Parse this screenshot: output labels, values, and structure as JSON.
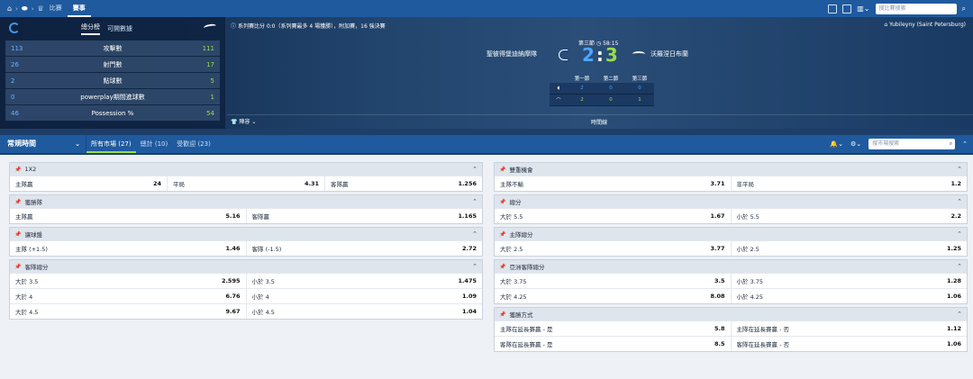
{
  "topbar": {
    "tabs": [
      "比賽",
      "賽事"
    ],
    "active_tab": 1,
    "search_placeholder": "搜比賽搜索"
  },
  "stats": {
    "tabs": [
      "總分榜",
      "可開數據"
    ],
    "rows": [
      {
        "home": "113",
        "name": "攻擊數",
        "away": "111"
      },
      {
        "home": "26",
        "name": "射門數",
        "away": "17"
      },
      {
        "home": "2",
        "name": "點球數",
        "away": "5"
      },
      {
        "home": "0",
        "name": "powerplay期間進球數",
        "away": "1"
      },
      {
        "home": "46",
        "name": "Possession %",
        "away": "54"
      }
    ]
  },
  "match": {
    "series_info": "系列賽比分 0:0（系列賽最多 4 場獲勝），附加賽，16 強決賽",
    "venue": "Yubileyny (Saint Petersburg)",
    "home_team": "聖彼得堡迪納摩隊",
    "away_team": "沃羅涅日布蘭",
    "period": "第三節",
    "clock": "58:15",
    "home_score": "2",
    "away_score": "3",
    "period_headers": [
      "第一節",
      "第二節",
      "第三節"
    ],
    "home_periods": [
      "2",
      "0",
      "0"
    ],
    "away_periods": [
      "2",
      "0",
      "1"
    ],
    "lineup_label": "陣容",
    "timeline_label": "時間線"
  },
  "filter": {
    "period_select": "常規時間",
    "tabs": [
      "所有市場 (27)",
      "總計 (10)",
      "受歡迎 (23)"
    ],
    "search_placeholder": "搜市場搜索"
  },
  "markets_left": [
    {
      "title": "1X2",
      "rows": [
        [
          [
            "主隊贏",
            "24"
          ],
          [
            "平局",
            "4.31"
          ],
          [
            "客隊贏",
            "1.256"
          ]
        ]
      ]
    },
    {
      "title": "獲勝隊",
      "rows": [
        [
          [
            "主隊贏",
            "5.16"
          ],
          [
            "客隊贏",
            "1.165"
          ]
        ]
      ]
    },
    {
      "title": "讓球盤",
      "rows": [
        [
          [
            "主隊 (+1.5)",
            "1.46"
          ],
          [
            "客隊 (-1.5)",
            "2.72"
          ]
        ]
      ]
    },
    {
      "title": "客隊總分",
      "rows": [
        [
          [
            "大於 3.5",
            "2.595"
          ],
          [
            "小於 3.5",
            "1.475"
          ]
        ],
        [
          [
            "大於 4",
            "6.76"
          ],
          [
            "小於 4",
            "1.09"
          ]
        ],
        [
          [
            "大於 4.5",
            "9.67"
          ],
          [
            "小於 4.5",
            "1.04"
          ]
        ]
      ]
    }
  ],
  "markets_right": [
    {
      "title": "雙重機會",
      "rows": [
        [
          [
            "主隊不輸",
            "3.71"
          ],
          [
            "非平局",
            "1.2"
          ]
        ]
      ]
    },
    {
      "title": "總分",
      "rows": [
        [
          [
            "大於 5.5",
            "1.67"
          ],
          [
            "小於 5.5",
            "2.2"
          ]
        ]
      ]
    },
    {
      "title": "主隊總分",
      "rows": [
        [
          [
            "大於 2.5",
            "3.77"
          ],
          [
            "小於 2.5",
            "1.25"
          ]
        ]
      ]
    },
    {
      "title": "亞洲客隊總分",
      "rows": [
        [
          [
            "大於 3.75",
            "3.5"
          ],
          [
            "小於 3.75",
            "1.28"
          ]
        ],
        [
          [
            "大於 4.25",
            "8.08"
          ],
          [
            "小於 4.25",
            "1.06"
          ]
        ]
      ]
    },
    {
      "title": "獲勝方式",
      "rows": [
        [
          [
            "主隊在延長賽贏 - 是",
            "5.8"
          ],
          [
            "主隊在延長賽贏 - 否",
            "1.12"
          ]
        ],
        [
          [
            "客隊在延長賽贏 - 是",
            "8.5"
          ],
          [
            "客隊在延長賽贏 - 否",
            "1.06"
          ]
        ]
      ]
    }
  ]
}
